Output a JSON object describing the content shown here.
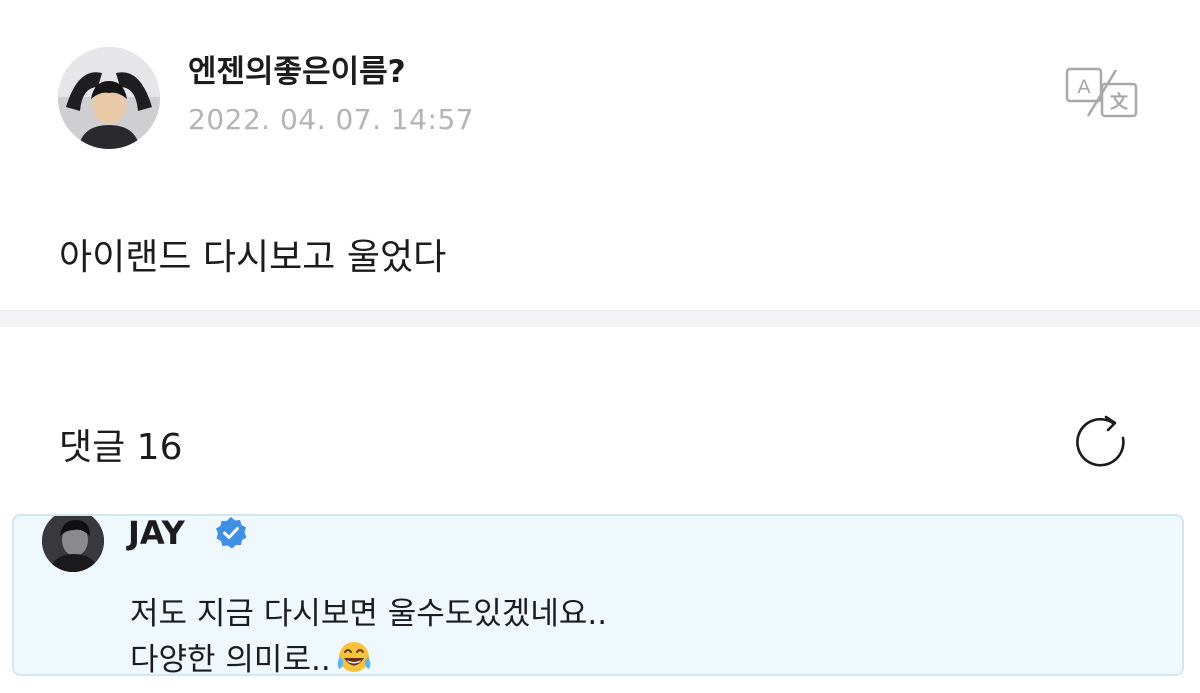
{
  "post": {
    "author": "엔젠의좋은이름?",
    "date": "2022. 04. 07. 14:57",
    "body": "아이랜드 다시보고 울었다"
  },
  "comments": {
    "title": "댓글 16",
    "items": [
      {
        "author": "JAY",
        "verified": true,
        "text_line1": "저도 지금 다시보면 울수도있겠네요..",
        "text_line2": "다양한 의미로..",
        "emoji": "face-with-tears-of-joy"
      }
    ]
  },
  "icons": {
    "translate": "translate-icon",
    "refresh": "refresh-icon",
    "verified": "verified-badge-icon"
  },
  "colors": {
    "highlight_background": "#eef8fd",
    "highlight_border": "#cfe8f4",
    "verified_blue": "#3f8fe3",
    "date_gray": "#b4b4b8",
    "divider": "#f3f3f5"
  }
}
